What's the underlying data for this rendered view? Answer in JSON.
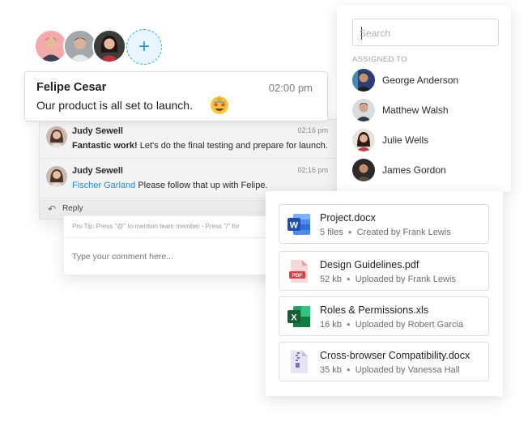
{
  "avatars": [
    {
      "name": "user-avatar-1",
      "bg": "#f2a6a6"
    },
    {
      "name": "user-avatar-2",
      "bg": "#9aa1a8"
    },
    {
      "name": "user-avatar-3",
      "bg": "#4a4a4a"
    }
  ],
  "add_user_label": "+",
  "featured_message": {
    "author": "Felipe Cesar",
    "time": "02:00 pm",
    "text": "Our product is all set to launch.",
    "emoji": "star-struck-emoji"
  },
  "thread": {
    "messages": [
      {
        "author": "Judy Sewell",
        "time": "02:16 pm",
        "bold": "Fantastic work!",
        "text": " Let's do the final testing and prepare for launch."
      },
      {
        "author": "Judy Sewell",
        "time": "02:16 pm",
        "mention": "Fischer Garland",
        "text": " Please follow that up with Felipe."
      }
    ],
    "reply_label": "Reply"
  },
  "comment": {
    "tip": "Pro Tip: Press \"@\" to mention team member   -   Press \"/\" for",
    "placeholder": "Type your comment here..."
  },
  "assign": {
    "search_placeholder": "Search",
    "label": "ASSIGNED TO",
    "people": [
      {
        "name": "George Anderson"
      },
      {
        "name": "Matthew Walsh"
      },
      {
        "name": "Julie Wells"
      },
      {
        "name": "James Gordon"
      }
    ]
  },
  "files": [
    {
      "title": "Project.docx",
      "meta1": "5 files",
      "meta2": "Created by Frank Lewis",
      "icon": "word-icon"
    },
    {
      "title": "Design Guidelines.pdf",
      "meta1": "52 kb",
      "meta2": "Uploaded by Frank Lewis",
      "icon": "pdf-icon"
    },
    {
      "title": "Roles & Permissions.xls",
      "meta1": "16 kb",
      "meta2": "Uploaded by Robert Garcia",
      "icon": "excel-icon"
    },
    {
      "title": "Cross-browser Compatibility.docx",
      "meta1": "35 kb",
      "meta2": "Uploaded by Vanessa Hall",
      "icon": "zip-icon"
    }
  ],
  "colors": {
    "accent": "#1f8fd6",
    "word": "#2b5fb9",
    "excel": "#1e7a45",
    "pdf": "#d9424a"
  }
}
